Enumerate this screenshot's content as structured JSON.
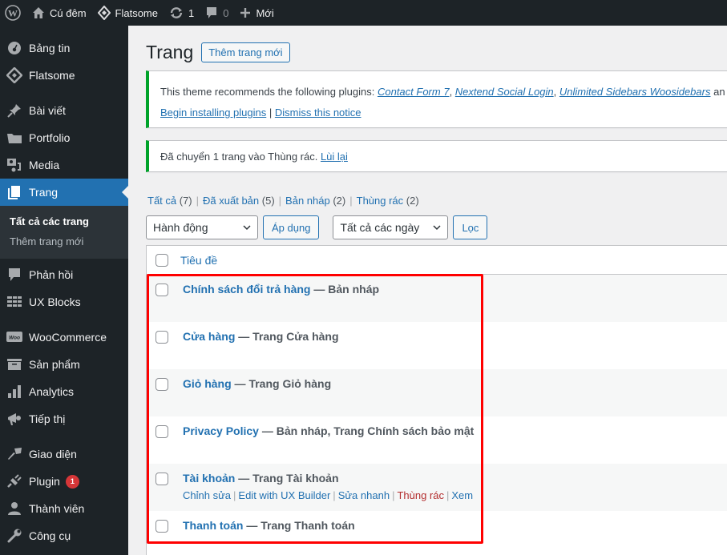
{
  "adminbar": {
    "site_name": "Cú đêm",
    "theme_name": "Flatsome",
    "updates_count": "1",
    "comments_count": "0",
    "new_label": "Mới"
  },
  "sidebar": {
    "items": [
      {
        "label": "Bảng tin",
        "icon": "dashboard-icon"
      },
      {
        "label": "Flatsome",
        "icon": "flatsome-icon"
      },
      {
        "label": "Bài viết",
        "icon": "pin-icon"
      },
      {
        "label": "Portfolio",
        "icon": "folder-icon"
      },
      {
        "label": "Media",
        "icon": "media-icon"
      },
      {
        "label": "Trang",
        "icon": "pages-icon"
      },
      {
        "label": "Phản hồi",
        "icon": "comment-icon"
      },
      {
        "label": "UX Blocks",
        "icon": "blocks-icon"
      },
      {
        "label": "WooCommerce",
        "icon": "woo-icon"
      },
      {
        "label": "Sản phẩm",
        "icon": "archive-icon"
      },
      {
        "label": "Analytics",
        "icon": "chart-icon"
      },
      {
        "label": "Tiếp thị",
        "icon": "megaphone-icon"
      },
      {
        "label": "Giao diện",
        "icon": "brush-icon"
      },
      {
        "label": "Plugin",
        "icon": "plugin-icon",
        "badge": "1"
      },
      {
        "label": "Thành viên",
        "icon": "user-icon"
      },
      {
        "label": "Công cụ",
        "icon": "wrench-icon"
      }
    ],
    "submenu": [
      {
        "label": "Tất cả các trang"
      },
      {
        "label": "Thêm trang mới"
      }
    ]
  },
  "header": {
    "title": "Trang",
    "add_new_label": "Thêm trang mới"
  },
  "notices": {
    "plugins": {
      "intro": "This theme recommends the following plugins: ",
      "links": [
        "Contact Form 7",
        "Nextend Social Login",
        "Unlimited Sidebars Woosidebars"
      ],
      "trailing": " an",
      "begin_label": "Begin installing plugins",
      "dismiss_label": "Dismiss this notice"
    },
    "trash": {
      "message": "Đã chuyển 1 trang vào Thùng rác. ",
      "undo_label": "Lùi lại"
    }
  },
  "filters": [
    {
      "label": "Tất cả",
      "count": "(7)"
    },
    {
      "label": "Đã xuất bản",
      "count": "(5)"
    },
    {
      "label": "Bản nháp",
      "count": "(2)"
    },
    {
      "label": "Thùng rác",
      "count": "(2)"
    }
  ],
  "tablenav": {
    "bulk_action": "Hành động",
    "apply_label": "Áp dụng",
    "date_filter": "Tất cả các ngày",
    "filter_label": "Lọc"
  },
  "table": {
    "header_title": "Tiêu đề",
    "rows": [
      {
        "title": "Chính sách đổi trả hàng",
        "state": " — Bản nháp"
      },
      {
        "title": "Cửa hàng",
        "state": " — Trang Cửa hàng"
      },
      {
        "title": "Giỏ hàng",
        "state": " — Trang Giỏ hàng"
      },
      {
        "title": "Privacy Policy",
        "state": " — Bản nháp, Trang Chính sách bảo mật"
      },
      {
        "title": "Tài khoản",
        "state": " — Trang Tài khoản"
      },
      {
        "title": "Thanh toán",
        "state": " — Trang Thanh toán"
      }
    ],
    "row_actions": {
      "edit": "Chỉnh sửa",
      "ux_builder": "Edit with UX Builder",
      "quick_edit": "Sửa nhanh",
      "trash": "Thùng rác",
      "view": "Xem"
    }
  },
  "colors": {
    "accent": "#2271b1",
    "adminbar_bg": "#1d2327",
    "notice_success": "#00a32a",
    "highlight": "#ff0000",
    "badge": "#d63638"
  }
}
